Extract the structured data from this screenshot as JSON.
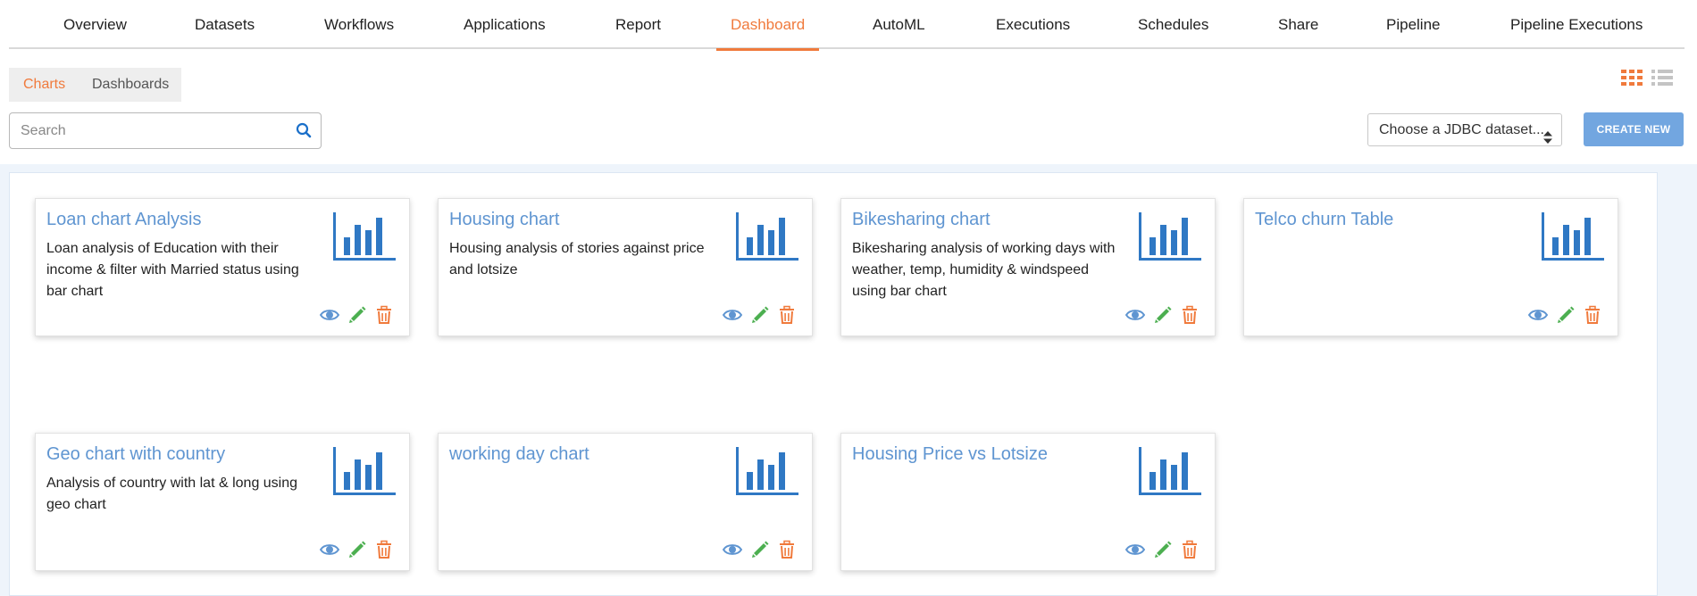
{
  "nav": {
    "items": [
      {
        "label": "Overview"
      },
      {
        "label": "Datasets"
      },
      {
        "label": "Workflows"
      },
      {
        "label": "Applications"
      },
      {
        "label": "Report"
      },
      {
        "label": "Dashboard"
      },
      {
        "label": "AutoML"
      },
      {
        "label": "Executions"
      },
      {
        "label": "Schedules"
      },
      {
        "label": "Share"
      },
      {
        "label": "Pipeline"
      },
      {
        "label": "Pipeline Executions"
      }
    ],
    "active": "Dashboard"
  },
  "subtabs": {
    "charts": "Charts",
    "dashboards": "Dashboards",
    "active": "Charts"
  },
  "toolbar": {
    "search_placeholder": "Search",
    "dataset_select": "Choose a JDBC dataset...",
    "create_label": "CREATE NEW",
    "view_mode": "grid"
  },
  "cards": [
    {
      "title": "Loan chart Analysis",
      "description": "Loan analysis of Education with their income & filter with Married status using bar chart"
    },
    {
      "title": "Housing chart",
      "description": "Housing analysis of stories against price and lotsize"
    },
    {
      "title": "Bikesharing chart",
      "description": "Bikesharing analysis of working days with weather, temp, humidity & windspeed using bar chart"
    },
    {
      "title": "Telco churn Table",
      "description": ""
    },
    {
      "title": "Geo chart with country",
      "description": "Analysis of country with lat & long using geo chart"
    },
    {
      "title": "working day chart",
      "description": ""
    },
    {
      "title": "Housing Price vs Lotsize",
      "description": ""
    }
  ],
  "icons": {
    "view": "eye-icon",
    "edit": "pencil-icon",
    "delete": "trash-icon",
    "chart": "bar-chart-icon"
  },
  "colors": {
    "accent": "#f07a3c",
    "link": "#5f95d1",
    "chart_icon": "#2f78c4",
    "view_icon": "#5f95d1",
    "edit_icon": "#4caf50",
    "delete_icon": "#f07a3c",
    "primary_button": "#72a6e0"
  }
}
